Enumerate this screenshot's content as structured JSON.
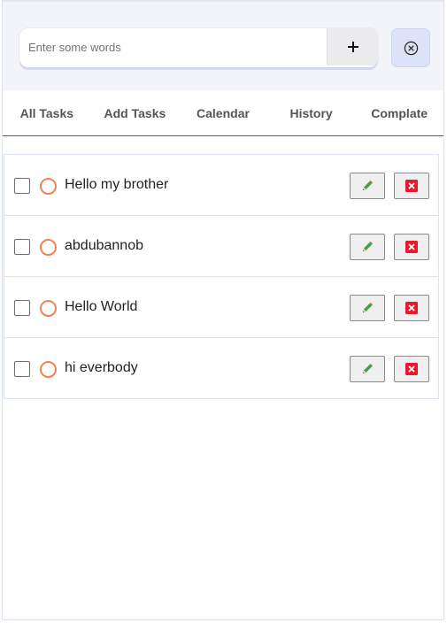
{
  "search": {
    "placeholder": "Enter some words",
    "value": ""
  },
  "buttons": {
    "add_icon": "plus-icon",
    "clear_icon": "circle-x-icon"
  },
  "tabs": [
    {
      "label": "All Tasks"
    },
    {
      "label": "Add Tasks"
    },
    {
      "label": "Calendar"
    },
    {
      "label": "History"
    },
    {
      "label": "Complate"
    }
  ],
  "tasks": [
    {
      "text": "Hello my brother",
      "checked": false
    },
    {
      "text": "abdubannob",
      "checked": false
    },
    {
      "text": "Hello World",
      "checked": false
    },
    {
      "text": "hi everbody",
      "checked": false
    }
  ],
  "colors": {
    "header_bg": "#f3f4f9",
    "tab_underline": "#2f7d2f",
    "radio_ring": "#f0834f",
    "delete_red": "#e8192c",
    "edit_pencil": "#43a047"
  },
  "row_icons": {
    "edit": "pencil-icon",
    "delete": "close-box-icon"
  }
}
